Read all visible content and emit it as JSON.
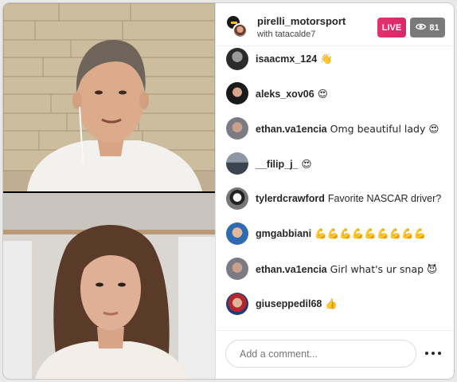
{
  "host": {
    "name": "pirelli_motorsport",
    "subtitle": "with tatacalde7"
  },
  "live_label": "LIVE",
  "viewer_count": "81",
  "comments": [
    {
      "user": "isaacmx_124",
      "text": "👋"
    },
    {
      "user": "aleks_xov06",
      "text": "😍"
    },
    {
      "user": "ethan.va1encia",
      "text": "Omg beautiful lady 😍"
    },
    {
      "user": "__filip_j_",
      "text": "😍"
    },
    {
      "user": "tylerdcrawford",
      "text": "Favorite NASCAR driver?"
    },
    {
      "user": "gmgabbiani",
      "text": "💪💪💪💪💪💪💪💪💪"
    },
    {
      "user": "ethan.va1encia",
      "text": "Girl what's ur snap 😈"
    },
    {
      "user": "giuseppedil68",
      "text": "👍"
    }
  ],
  "composer": {
    "placeholder": "Add a comment..."
  },
  "colors": {
    "live": "#e2336b",
    "viewer_badge": "#7a7a7a"
  },
  "icons": {
    "viewers": "eye-icon",
    "more": "more-options-icon"
  }
}
